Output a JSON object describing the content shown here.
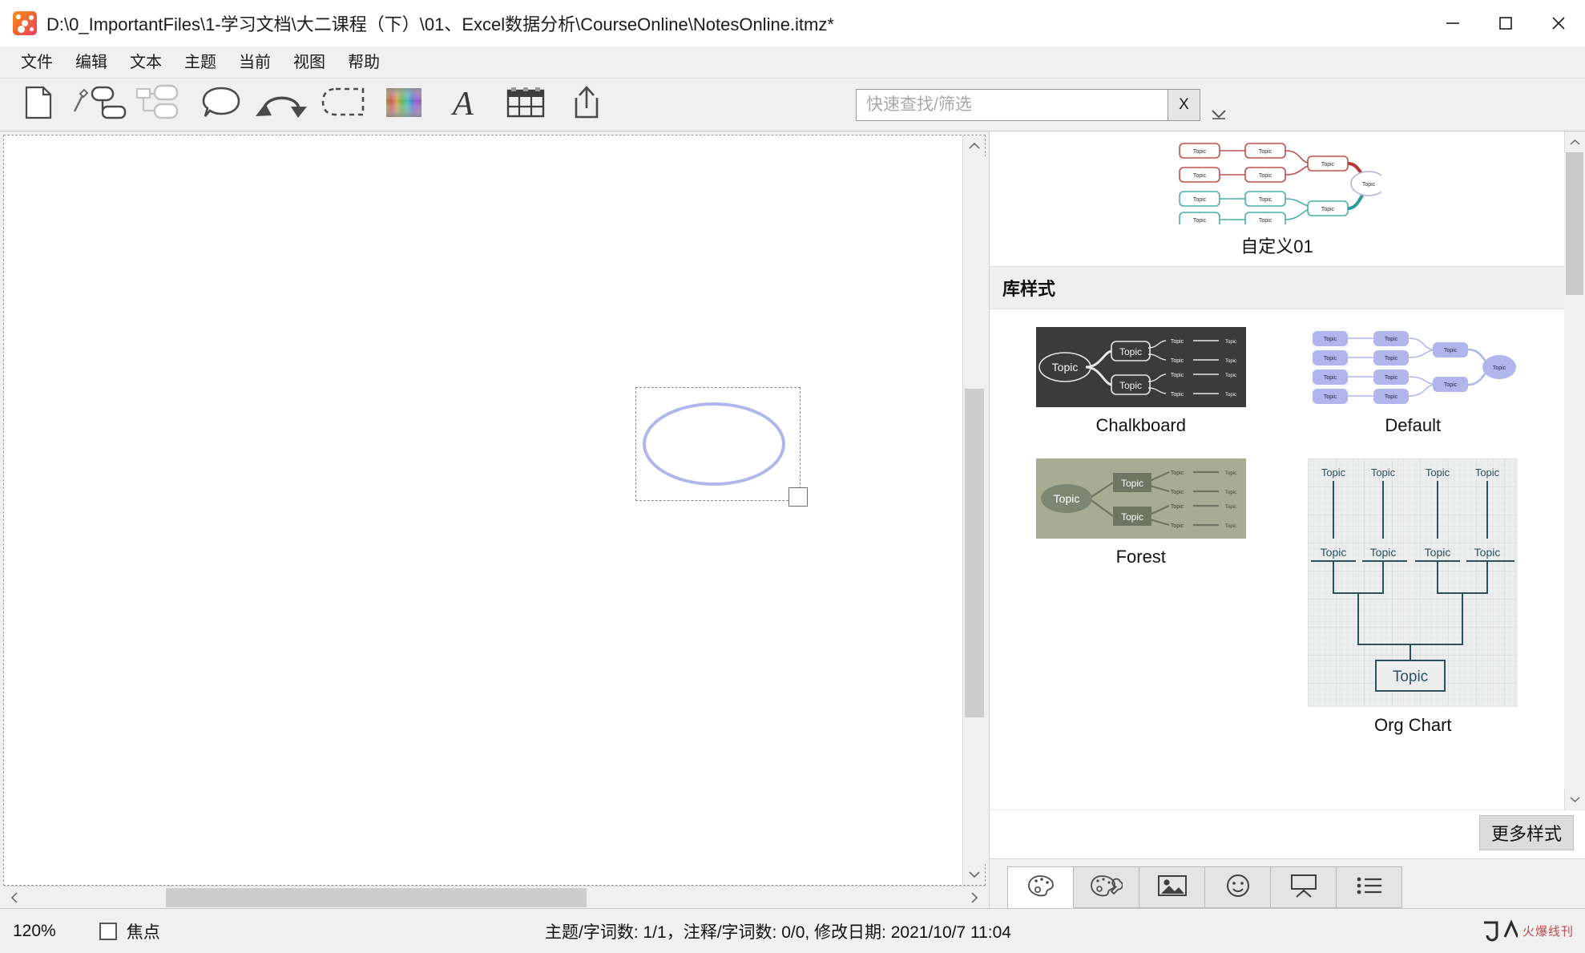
{
  "window": {
    "title": "D:\\0_ImportantFiles\\1-学习文档\\大二课程（下）\\01、Excel数据分析\\CourseOnline\\NotesOnline.itmz*",
    "app_icon": "mindmap-app-icon",
    "minimize": "—",
    "maximize": "▢",
    "close": "✕"
  },
  "menu": {
    "items": [
      {
        "label": "文件",
        "name": "menu-file"
      },
      {
        "label": "编辑",
        "name": "menu-edit"
      },
      {
        "label": "文本",
        "name": "menu-text"
      },
      {
        "label": "主题",
        "name": "menu-topic"
      },
      {
        "label": "当前",
        "name": "menu-current"
      },
      {
        "label": "视图",
        "name": "menu-view"
      },
      {
        "label": "帮助",
        "name": "menu-help"
      }
    ]
  },
  "toolbar": {
    "buttons": [
      {
        "icon": "new-document-icon",
        "name": "toolbar-new-document"
      },
      {
        "icon": "topic-shape-icon",
        "name": "toolbar-new-topic"
      },
      {
        "icon": "subtopic-icon",
        "name": "toolbar-new-subtopic"
      },
      {
        "icon": "callout-icon",
        "name": "toolbar-callout"
      },
      {
        "icon": "undo-redo-icon",
        "name": "toolbar-undo-redo"
      },
      {
        "icon": "boundary-icon",
        "name": "toolbar-boundary"
      },
      {
        "icon": "color-spectrum-icon",
        "name": "toolbar-colors"
      },
      {
        "icon": "font-icon",
        "name": "toolbar-fonts"
      },
      {
        "icon": "table-icon",
        "name": "toolbar-table"
      },
      {
        "icon": "share-icon",
        "name": "toolbar-share"
      }
    ],
    "overflow": "chevron-down-icon",
    "search": {
      "placeholder": "快速查找/筛选",
      "value": "",
      "clear_label": "X"
    }
  },
  "canvas": {
    "selected_shape": "ellipse",
    "resize_handle": "resize-handle"
  },
  "side_panel": {
    "custom_section": {
      "items": [
        {
          "caption": "自定义01",
          "name": "style-custom-01"
        }
      ]
    },
    "library_section": {
      "header": "库样式",
      "items": [
        {
          "caption": "Chalkboard",
          "name": "style-chalkboard"
        },
        {
          "caption": "Default",
          "name": "style-default"
        },
        {
          "caption": "Forest",
          "name": "style-forest"
        },
        {
          "caption": "Org Chart",
          "name": "style-org-chart"
        }
      ]
    },
    "node_label": "Topic",
    "more_button": "更多样式",
    "tabs": [
      {
        "icon": "palette-icon",
        "name": "tab-style",
        "active": true
      },
      {
        "icon": "palette-wrench-icon",
        "name": "tab-style-editor",
        "active": false
      },
      {
        "icon": "image-icon",
        "name": "tab-images",
        "active": false
      },
      {
        "icon": "smiley-icon",
        "name": "tab-stickers",
        "active": false
      },
      {
        "icon": "presentation-icon",
        "name": "tab-presentation",
        "active": false
      },
      {
        "icon": "list-icon",
        "name": "tab-outline",
        "active": false
      }
    ]
  },
  "status_bar": {
    "zoom": "120%",
    "focus_label": "焦点",
    "focus_checked": false,
    "info": "主题/字词数: 1/1，注释/字词数: 0/0, 修改日期: 2021/10/7 11:04",
    "watermark": "火爆线刊"
  },
  "colors": {
    "accent": "#b0b6ec",
    "chalkboard_bg": "#3b3b3b",
    "forest_bg": "#a7ac92",
    "orgchart_line": "#2d4f5e",
    "custom_red": "#c0504d",
    "custom_teal": "#4bada8",
    "watermark": "#c64a4a"
  }
}
